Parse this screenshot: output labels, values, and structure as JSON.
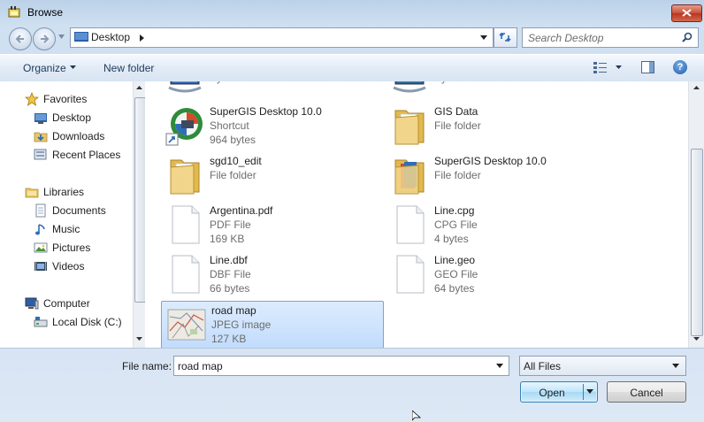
{
  "window": {
    "title": "Browse",
    "close_label": "Close"
  },
  "address": {
    "location": "Desktop",
    "separator": "▸"
  },
  "search": {
    "placeholder": "Search Desktop"
  },
  "toolbar": {
    "organize": "Organize",
    "new_folder": "New folder",
    "help": "?"
  },
  "sidebar": {
    "groups": [
      {
        "label": "Favorites",
        "icon": "star-icon",
        "items": [
          {
            "label": "Desktop",
            "icon": "desktop-icon"
          },
          {
            "label": "Downloads",
            "icon": "downloads-icon"
          },
          {
            "label": "Recent Places",
            "icon": "recent-places-icon"
          }
        ]
      },
      {
        "label": "Libraries",
        "icon": "libraries-icon",
        "items": [
          {
            "label": "Documents",
            "icon": "documents-icon"
          },
          {
            "label": "Music",
            "icon": "music-icon"
          },
          {
            "label": "Pictures",
            "icon": "pictures-icon"
          },
          {
            "label": "Videos",
            "icon": "videos-icon"
          }
        ]
      },
      {
        "label": "Computer",
        "icon": "computer-icon",
        "items": [
          {
            "label": "Local Disk (C:)",
            "icon": "local-disk-icon"
          }
        ]
      }
    ]
  },
  "files": [
    {
      "name": "",
      "type": "System Folder",
      "size": "",
      "icon": "computer-icon"
    },
    {
      "name": "",
      "type": "System Folder",
      "size": "",
      "icon": "network-icon"
    },
    {
      "name": "SuperGIS Desktop 10.0",
      "type": "Shortcut",
      "size": "964 bytes",
      "icon": "supergis-shortcut-icon"
    },
    {
      "name": "GIS Data",
      "type": "File folder",
      "size": "",
      "icon": "folder-icon"
    },
    {
      "name": "sgd10_edit",
      "type": "File folder",
      "size": "",
      "icon": "folder-icon"
    },
    {
      "name": "SuperGIS Desktop 10.0",
      "type": "File folder",
      "size": "",
      "icon": "folder-icon"
    },
    {
      "name": "Argentina.pdf",
      "type": "PDF File",
      "size": "169 KB",
      "icon": "document-icon"
    },
    {
      "name": "Line.cpg",
      "type": "CPG File",
      "size": "4 bytes",
      "icon": "document-icon"
    },
    {
      "name": "Line.dbf",
      "type": "DBF File",
      "size": "66 bytes",
      "icon": "document-icon"
    },
    {
      "name": "Line.geo",
      "type": "GEO File",
      "size": "64 bytes",
      "icon": "document-icon"
    },
    {
      "name": "road map",
      "type": "JPEG image",
      "size": "127 KB",
      "icon": "map-thumbnail-icon",
      "selected": true
    }
  ],
  "footer": {
    "file_name_label": "File name:",
    "file_name_value": "road map",
    "filter_value": "All Files",
    "open_label": "Open",
    "cancel_label": "Cancel"
  },
  "colors": {
    "accent": "#3c7fb1",
    "selection": "#c2dcfd",
    "chrome": "#cfe0f1"
  }
}
